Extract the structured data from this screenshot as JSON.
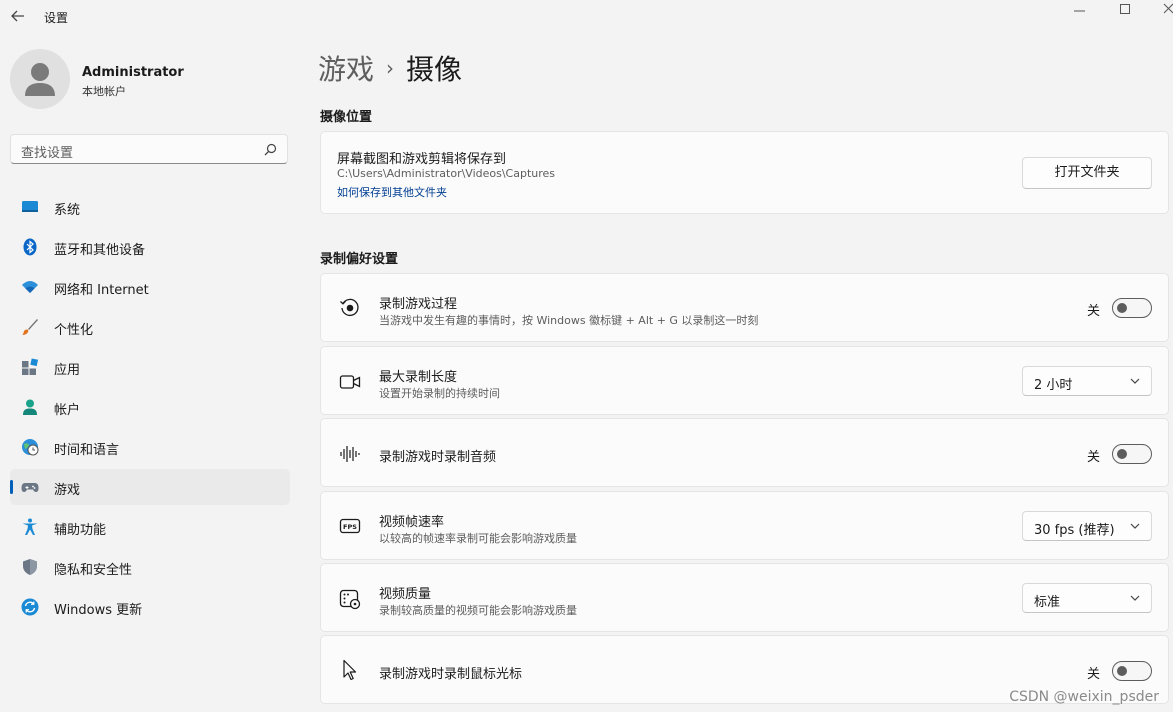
{
  "window": {
    "title": "设置",
    "controls": [
      "minimize-icon",
      "maximize-icon",
      "close-icon"
    ]
  },
  "user": {
    "name": "Administrator",
    "account_type": "本地帐户"
  },
  "search": {
    "placeholder": "查找设置"
  },
  "sidebar": {
    "items": [
      {
        "label": "系统",
        "icon": "system-icon"
      },
      {
        "label": "蓝牙和其他设备",
        "icon": "bluetooth-icon"
      },
      {
        "label": "网络和 Internet",
        "icon": "wifi-icon"
      },
      {
        "label": "个性化",
        "icon": "brush-icon"
      },
      {
        "label": "应用",
        "icon": "apps-icon"
      },
      {
        "label": "帐户",
        "icon": "account-icon"
      },
      {
        "label": "时间和语言",
        "icon": "globe-clock-icon"
      },
      {
        "label": "游戏",
        "icon": "gamepad-icon",
        "selected": true
      },
      {
        "label": "辅助功能",
        "icon": "accessibility-icon"
      },
      {
        "label": "隐私和安全性",
        "icon": "shield-icon"
      },
      {
        "label": "Windows 更新",
        "icon": "update-icon"
      }
    ]
  },
  "breadcrumb": {
    "parent": "游戏",
    "separator": "›",
    "current": "摄像"
  },
  "capture_location": {
    "section_title": "摄像位置",
    "title": "屏幕截图和游戏剪辑将保存到",
    "path": "C:\\Users\\Administrator\\Videos\\Captures",
    "link": "如何保存到其他文件夹",
    "button": "打开文件夹"
  },
  "recording": {
    "section_title": "录制偏好设置",
    "rows": [
      {
        "title": "录制游戏过程",
        "desc": "当游戏中发生有趣的事情时，按 Windows 徽标键 + Alt + G 以录制这一时刻",
        "icon": "record-icon",
        "control": "toggle",
        "state": "关"
      },
      {
        "title": "最大录制长度",
        "desc": "设置开始录制的持续时间",
        "icon": "video-camera-icon",
        "control": "dropdown",
        "value": "2 小时"
      },
      {
        "title": "录制游戏时录制音频",
        "desc": "",
        "icon": "audio-wave-icon",
        "control": "toggle",
        "state": "关"
      },
      {
        "title": "视频帧速率",
        "desc": "以较高的帧速率录制可能会影响游戏质量",
        "icon": "fps-icon",
        "control": "dropdown",
        "value": "30 fps (推荐)"
      },
      {
        "title": "视频质量",
        "desc": "录制较高质量的视频可能会影响游戏质量",
        "icon": "video-quality-icon",
        "control": "dropdown",
        "value": "标准"
      },
      {
        "title": "录制游戏时录制鼠标光标",
        "desc": "",
        "icon": "cursor-icon",
        "control": "toggle",
        "state": "关"
      }
    ]
  },
  "watermark": "CSDN @weixin_psder",
  "colors": {
    "accent": "#005fb8",
    "background": "#f3f3f3",
    "card": "#fbfbfb",
    "link": "#003e92"
  }
}
